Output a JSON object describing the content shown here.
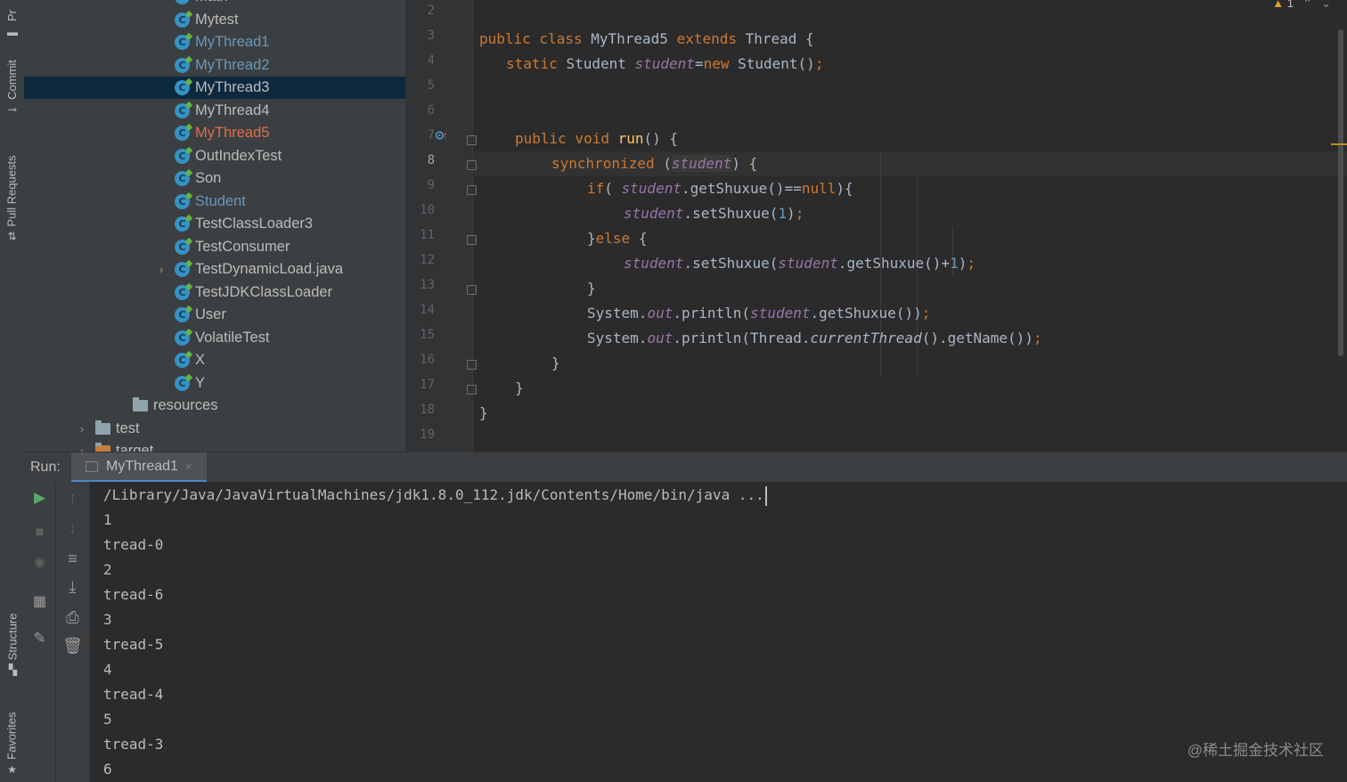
{
  "tool_strip": {
    "project_label": "Pr",
    "commit_label": "Commit",
    "pull_requests_label": "Pull Requests",
    "structure_label": "Structure",
    "favorites_label": "Favorites"
  },
  "project_tree": {
    "items": [
      {
        "label": "Math",
        "kind": "class",
        "color": "#bbbbbb"
      },
      {
        "label": "Mytest",
        "kind": "class",
        "color": "#bbbbbb"
      },
      {
        "label": "MyThread1",
        "kind": "class",
        "color": "#6897bb"
      },
      {
        "label": "MyThread2",
        "kind": "class",
        "color": "#6897bb"
      },
      {
        "label": "MyThread3",
        "kind": "class",
        "color": "#bbbbbb",
        "selected": true
      },
      {
        "label": "MyThread4",
        "kind": "class",
        "color": "#bbbbbb"
      },
      {
        "label": "MyThread5",
        "kind": "class",
        "color": "#e06c4b"
      },
      {
        "label": "OutIndexTest",
        "kind": "class",
        "color": "#bbbbbb"
      },
      {
        "label": "Son",
        "kind": "class",
        "color": "#bbbbbb"
      },
      {
        "label": "Student",
        "kind": "class",
        "color": "#6897bb"
      },
      {
        "label": "TestClassLoader3",
        "kind": "class",
        "color": "#bbbbbb"
      },
      {
        "label": "TestConsumer",
        "kind": "class",
        "color": "#bbbbbb"
      },
      {
        "label": "TestDynamicLoad.java",
        "kind": "class",
        "color": "#bbbbbb",
        "expandable": true
      },
      {
        "label": "TestJDKClassLoader",
        "kind": "class",
        "color": "#bbbbbb"
      },
      {
        "label": "User",
        "kind": "class",
        "color": "#bbbbbb"
      },
      {
        "label": "VolatileTest",
        "kind": "class",
        "color": "#bbbbbb"
      },
      {
        "label": "X",
        "kind": "class",
        "color": "#bbbbbb"
      },
      {
        "label": "Y",
        "kind": "class",
        "color": "#bbbbbb"
      },
      {
        "label": "resources",
        "kind": "folder",
        "color": "#bbbbbb"
      },
      {
        "label": "test",
        "kind": "folder",
        "color": "#bbbbbb",
        "expandable": true
      },
      {
        "label": "target",
        "kind": "folder",
        "color": "#bbbbbb",
        "expandable": true
      }
    ]
  },
  "editor": {
    "warning_count": "1",
    "current_line": 8,
    "line_numbers": [
      "2",
      "3",
      "4",
      "5",
      "6",
      "7",
      "8",
      "9",
      "10",
      "11",
      "12",
      "13",
      "14",
      "15",
      "16",
      "17",
      "18",
      "19"
    ],
    "code": {
      "l3_kw1": "public class ",
      "l3_name": "MyThread5 ",
      "l3_kw2": "extends ",
      "l3_rest": "Thread {",
      "l4_kw": "static ",
      "l4_type": "Student ",
      "l4_field": "student",
      "l4_eq": "=",
      "l4_new": "new ",
      "l4_rest": "Student()",
      "l4_semi": ";",
      "l7_kw": "public void ",
      "l7_fn": "run",
      "l7_rest": "() {",
      "l8_kw": "synchronized ",
      "l8_open": "(",
      "l8_field": "student",
      "l8_close": ") {",
      "l9_kw": "if",
      "l9_open": "( ",
      "l9_field": "student",
      "l9_call": ".getShuxue()==",
      "l9_null": "null",
      "l9_close": "){",
      "l10_field": "student",
      "l10_call": ".setShuxue(",
      "l10_num": "1",
      "l10_close": ")",
      "l10_semi": ";",
      "l11_brace": "}",
      "l11_kw": "else ",
      "l11_open": "{",
      "l12_field1": "student",
      "l12_call1": ".setShuxue(",
      "l12_field2": "student",
      "l12_call2": ".getShuxue()+",
      "l12_num": "1",
      "l12_close": ")",
      "l12_semi": ";",
      "l13_brace": "}",
      "l14_sys": "System.",
      "l14_out": "out",
      "l14_call": ".println(",
      "l14_field": "student",
      "l14_rest": ".getShuxue())",
      "l14_semi": ";",
      "l15_sys": "System.",
      "l15_out": "out",
      "l15_call": ".println(Thread.",
      "l15_cur": "currentThread",
      "l15_rest": "().getName())",
      "l15_semi": ";",
      "l16_brace": "}",
      "l17_brace": "}",
      "l18_brace": "}"
    }
  },
  "run_panel": {
    "label": "Run:",
    "tab_label": "MyThread1",
    "tab_close": "×",
    "console_lines": [
      "/Library/Java/JavaVirtualMachines/jdk1.8.0_112.jdk/Contents/Home/bin/java ...",
      "1",
      "tread-0",
      "2",
      "tread-6",
      "3",
      "tread-5",
      "4",
      "tread-4",
      "5",
      "tread-3",
      "6"
    ],
    "toolbar_icons": [
      "run-icon",
      "stop-icon",
      "debug-icon",
      "layout-icon",
      "pin-icon",
      "up-arrow-icon",
      "down-arrow-icon",
      "soft-wrap-icon",
      "scroll-to-end-icon",
      "print-icon",
      "trash-icon"
    ]
  },
  "watermark": "@稀土掘金技术社区",
  "colors": {
    "background": "#2b2b2b",
    "panel": "#3c3f41",
    "keyword": "#cc7832",
    "field": "#9876aa",
    "number": "#6897bb",
    "function": "#ffc66d",
    "selection": "#0d293e"
  }
}
